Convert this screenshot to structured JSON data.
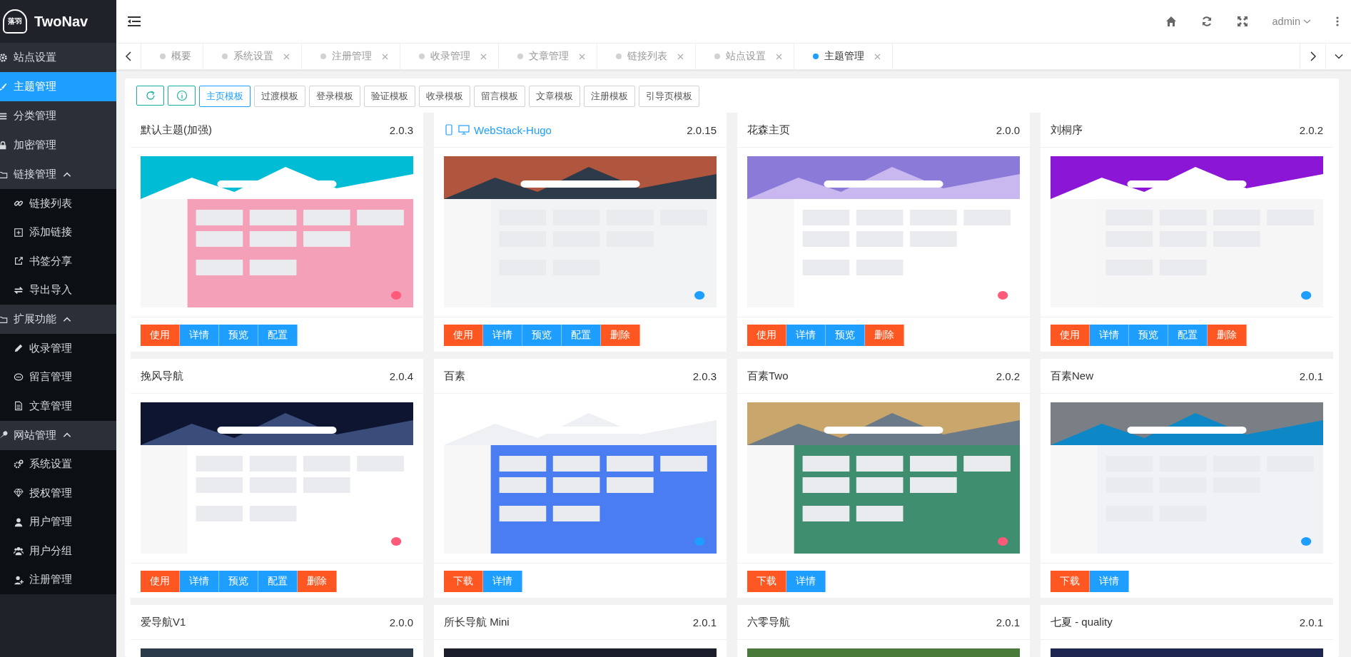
{
  "brand": {
    "name": "TwoNav",
    "logo_text": "落羽"
  },
  "sidebar": {
    "items": [
      {
        "label": "站点设置",
        "selected": false
      },
      {
        "label": "主题管理",
        "selected": true
      },
      {
        "label": "分类管理",
        "selected": false
      },
      {
        "label": "加密管理",
        "selected": false
      },
      {
        "label": "链接管理",
        "expanded": true,
        "children": [
          {
            "label": "链接列表",
            "selected": false
          },
          {
            "label": "添加链接",
            "selected": false
          },
          {
            "label": "书签分享",
            "selected": false
          },
          {
            "label": "导出导入",
            "selected": false
          }
        ]
      },
      {
        "label": "扩展功能",
        "expanded": true,
        "children": [
          {
            "label": "收录管理",
            "selected": false
          },
          {
            "label": "留言管理",
            "selected": false
          },
          {
            "label": "文章管理",
            "selected": false
          }
        ]
      },
      {
        "label": "网站管理",
        "expanded": true,
        "children": [
          {
            "label": "系统设置",
            "selected": false
          },
          {
            "label": "授权管理",
            "selected": false
          },
          {
            "label": "用户管理",
            "selected": false
          },
          {
            "label": "用户分组",
            "selected": false
          },
          {
            "label": "注册管理",
            "selected": false
          }
        ]
      }
    ]
  },
  "header": {
    "user": "admin"
  },
  "tabs": [
    {
      "label": "概要",
      "closable": false,
      "selected": false
    },
    {
      "label": "系统设置",
      "closable": true,
      "selected": false
    },
    {
      "label": "注册管理",
      "closable": true,
      "selected": false
    },
    {
      "label": "收录管理",
      "closable": true,
      "selected": false
    },
    {
      "label": "文章管理",
      "closable": true,
      "selected": false
    },
    {
      "label": "链接列表",
      "closable": true,
      "selected": false
    },
    {
      "label": "站点设置",
      "closable": true,
      "selected": false
    },
    {
      "label": "主题管理",
      "closable": true,
      "selected": true
    }
  ],
  "template_tabs": [
    {
      "label": "主页模板",
      "selected": true
    },
    {
      "label": "过渡模板",
      "selected": false
    },
    {
      "label": "登录模板",
      "selected": false
    },
    {
      "label": "验证模板",
      "selected": false
    },
    {
      "label": "收录模板",
      "selected": false
    },
    {
      "label": "留言模板",
      "selected": false
    },
    {
      "label": "文章模板",
      "selected": false
    },
    {
      "label": "注册模板",
      "selected": false
    },
    {
      "label": "引导页模板",
      "selected": false
    }
  ],
  "themes": [
    {
      "title": "默认主题(加强)",
      "version": "2.0.3",
      "responsive": false,
      "picture": {
        "kind": "picture"
      },
      "buttons": [
        {
          "label": "使用",
          "kind": "use"
        },
        {
          "label": "详情",
          "kind": "normal"
        },
        {
          "label": "预览",
          "kind": "normal"
        },
        {
          "label": "配置",
          "kind": "normal"
        }
      ]
    },
    {
      "title": "WebStack-Hugo",
      "version": "2.0.15",
      "responsive": true,
      "picture": {
        "kind": "picture"
      },
      "buttons": [
        {
          "label": "使用",
          "kind": "use"
        },
        {
          "label": "详情",
          "kind": "normal"
        },
        {
          "label": "预览",
          "kind": "normal"
        },
        {
          "label": "配置",
          "kind": "normal"
        },
        {
          "label": "删除",
          "kind": "danger"
        }
      ]
    },
    {
      "title": "花森主页",
      "version": "2.0.0",
      "responsive": false,
      "picture": {
        "kind": "picture"
      },
      "buttons": [
        {
          "label": "使用",
          "kind": "use"
        },
        {
          "label": "详情",
          "kind": "normal"
        },
        {
          "label": "预览",
          "kind": "normal"
        },
        {
          "label": "删除",
          "kind": "danger"
        }
      ]
    },
    {
      "title": "刘桐序",
      "version": "2.0.2",
      "responsive": false,
      "picture": {
        "kind": "picture"
      },
      "buttons": [
        {
          "label": "使用",
          "kind": "use"
        },
        {
          "label": "详情",
          "kind": "normal"
        },
        {
          "label": "预览",
          "kind": "normal"
        },
        {
          "label": "配置",
          "kind": "normal"
        },
        {
          "label": "删除",
          "kind": "danger"
        }
      ]
    },
    {
      "title": "挽风导航",
      "version": "2.0.4",
      "responsive": false,
      "picture": {
        "kind": "picture"
      },
      "buttons": [
        {
          "label": "使用",
          "kind": "use"
        },
        {
          "label": "详情",
          "kind": "normal"
        },
        {
          "label": "预览",
          "kind": "normal"
        },
        {
          "label": "配置",
          "kind": "normal"
        },
        {
          "label": "删除",
          "kind": "danger"
        }
      ]
    },
    {
      "title": "百素",
      "version": "2.0.3",
      "responsive": false,
      "picture": {
        "kind": "picture"
      },
      "buttons": [
        {
          "label": "下载",
          "kind": "use"
        },
        {
          "label": "详情",
          "kind": "normal"
        }
      ]
    },
    {
      "title": "百素Two",
      "version": "2.0.2",
      "responsive": false,
      "picture": {
        "kind": "picture"
      },
      "buttons": [
        {
          "label": "下载",
          "kind": "use"
        },
        {
          "label": "详情",
          "kind": "normal"
        }
      ]
    },
    {
      "title": "百素New",
      "version": "2.0.1",
      "responsive": false,
      "picture": {
        "kind": "picture"
      },
      "buttons": [
        {
          "label": "下载",
          "kind": "use"
        },
        {
          "label": "详情",
          "kind": "normal"
        }
      ]
    },
    {
      "title": "爱导航V1",
      "version": "2.0.0",
      "responsive": false,
      "picture": {
        "kind": "picture"
      }
    },
    {
      "title": "所长导航 Mini",
      "version": "2.0.1",
      "responsive": false,
      "picture": {
        "kind": "picture"
      }
    },
    {
      "title": "六零导航",
      "version": "2.0.1",
      "responsive": false,
      "picture": {
        "kind": "picture"
      }
    },
    {
      "title": "七夏 - quality",
      "version": "2.0.1",
      "responsive": false,
      "picture": {
        "kind": "picture"
      }
    }
  ]
}
